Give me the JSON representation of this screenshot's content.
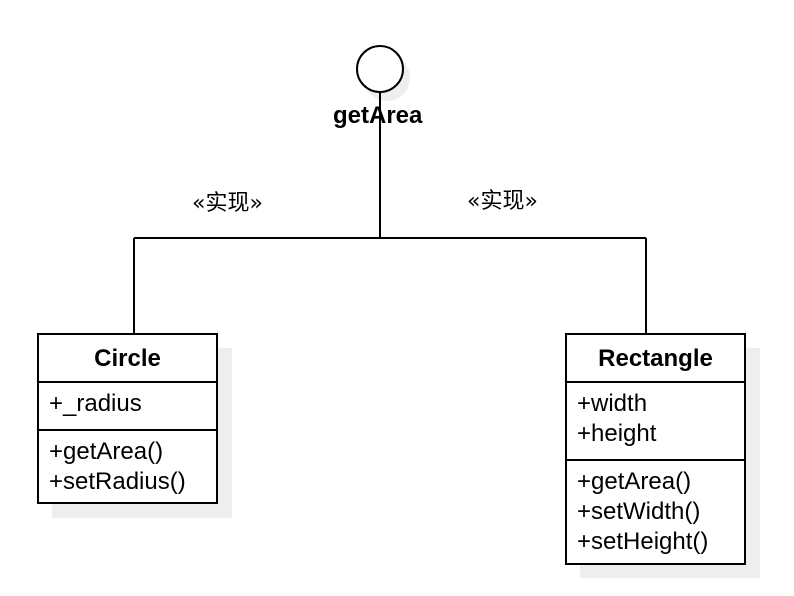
{
  "interface": {
    "name": "getArea"
  },
  "relations": {
    "left_stereotype": "«实现»",
    "right_stereotype": "«实现»"
  },
  "classes": {
    "circle": {
      "name": "Circle",
      "attributes": [
        "+_radius"
      ],
      "operations": [
        "+getArea()",
        "+setRadius()"
      ]
    },
    "rectangle": {
      "name": "Rectangle",
      "attributes": [
        "+width",
        "+height"
      ],
      "operations": [
        "+getArea()",
        "+setWidth()",
        "+setHeight()"
      ]
    }
  }
}
